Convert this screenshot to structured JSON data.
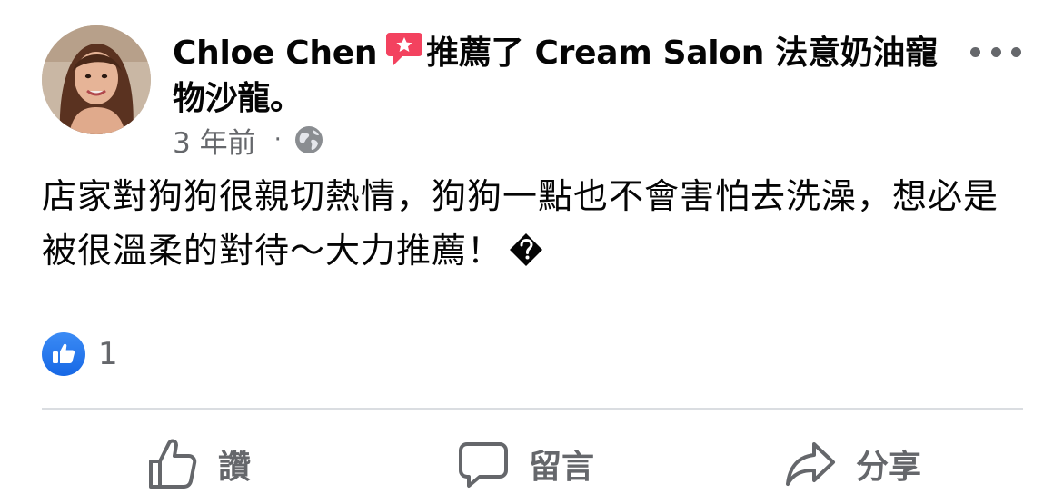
{
  "post": {
    "author": "Chloe Chen",
    "action": "推薦了 Cream Salon 法意奶油寵物沙龍。",
    "timestamp": "3 年前",
    "separator": "·",
    "privacy_icon": "globe-icon",
    "body_text": "店家對狗狗很親切熱情，狗狗一點也不會害怕去洗澡，想必是被很溫柔的對待～大力推薦！",
    "reaction_count": "1",
    "reaction_icon": "like-badge-icon"
  },
  "actions": {
    "like_label": "讚",
    "comment_label": "留言",
    "share_label": "分享"
  },
  "colors": {
    "text_primary": "#050505",
    "text_secondary": "#65676b",
    "like_blue": "#1877f2",
    "recommend_red": "#f3425f",
    "divider": "#dadde1"
  }
}
